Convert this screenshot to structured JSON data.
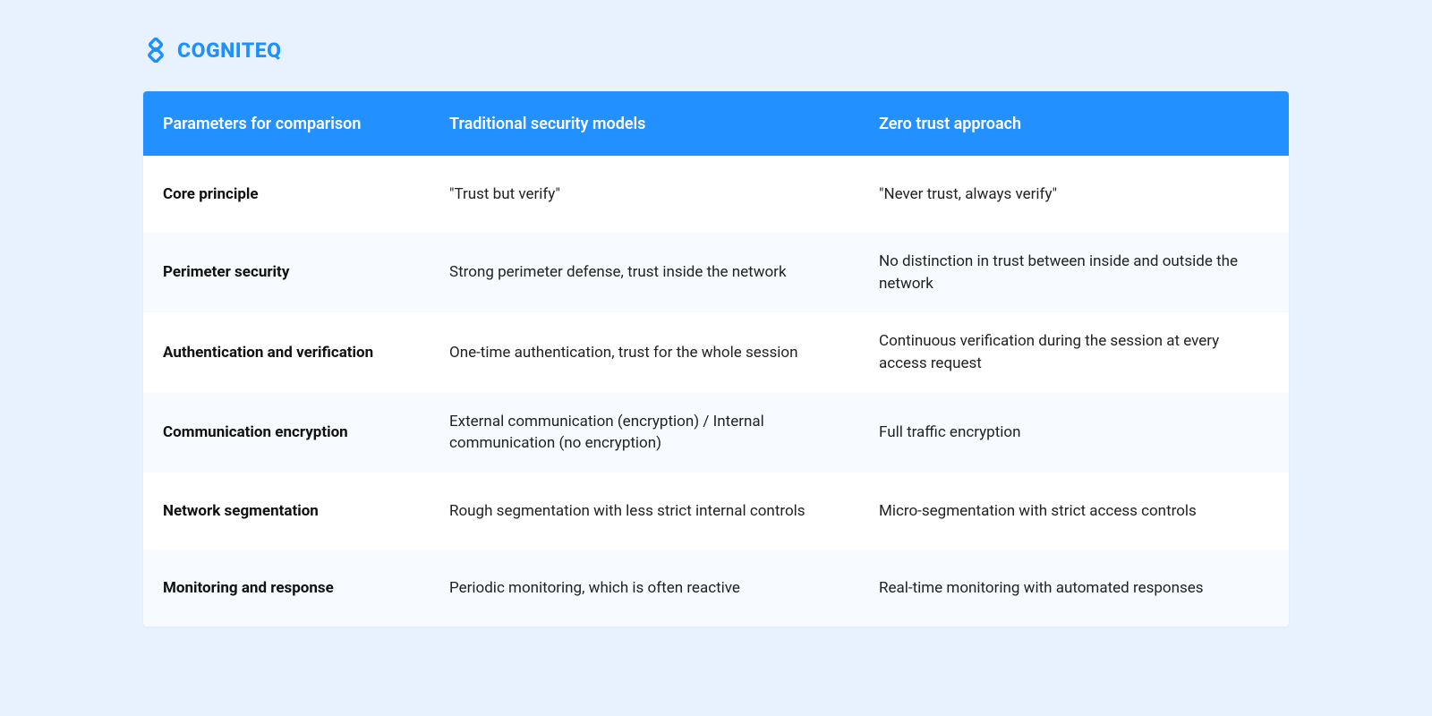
{
  "brand": {
    "name": "COGNITEQ"
  },
  "table": {
    "headers": {
      "param": "Parameters for comparison",
      "traditional": "Traditional security models",
      "zero_trust": "Zero trust approach"
    },
    "rows": [
      {
        "param": "Core principle",
        "traditional": "\"Trust but verify\"",
        "zero_trust": "\"Never trust, always verify\""
      },
      {
        "param": "Perimeter security",
        "traditional": "Strong perimeter defense, trust inside the network",
        "zero_trust": "No distinction in trust between inside and outside the network"
      },
      {
        "param": "Authentication and verification",
        "traditional": "One-time authentication, trust for the whole session",
        "zero_trust": "Continuous verification during the session at every access request"
      },
      {
        "param": "Communication encryption",
        "traditional": "External communication (encryption) / Internal communication (no encryption)",
        "zero_trust": "Full traffic encryption"
      },
      {
        "param": "Network segmentation",
        "traditional": "Rough segmentation with less strict internal controls",
        "zero_trust": "Micro-segmentation with strict access controls"
      },
      {
        "param": "Monitoring and response",
        "traditional": "Periodic monitoring, which is often reactive",
        "zero_trust": "Real-time monitoring with automated responses"
      }
    ]
  }
}
